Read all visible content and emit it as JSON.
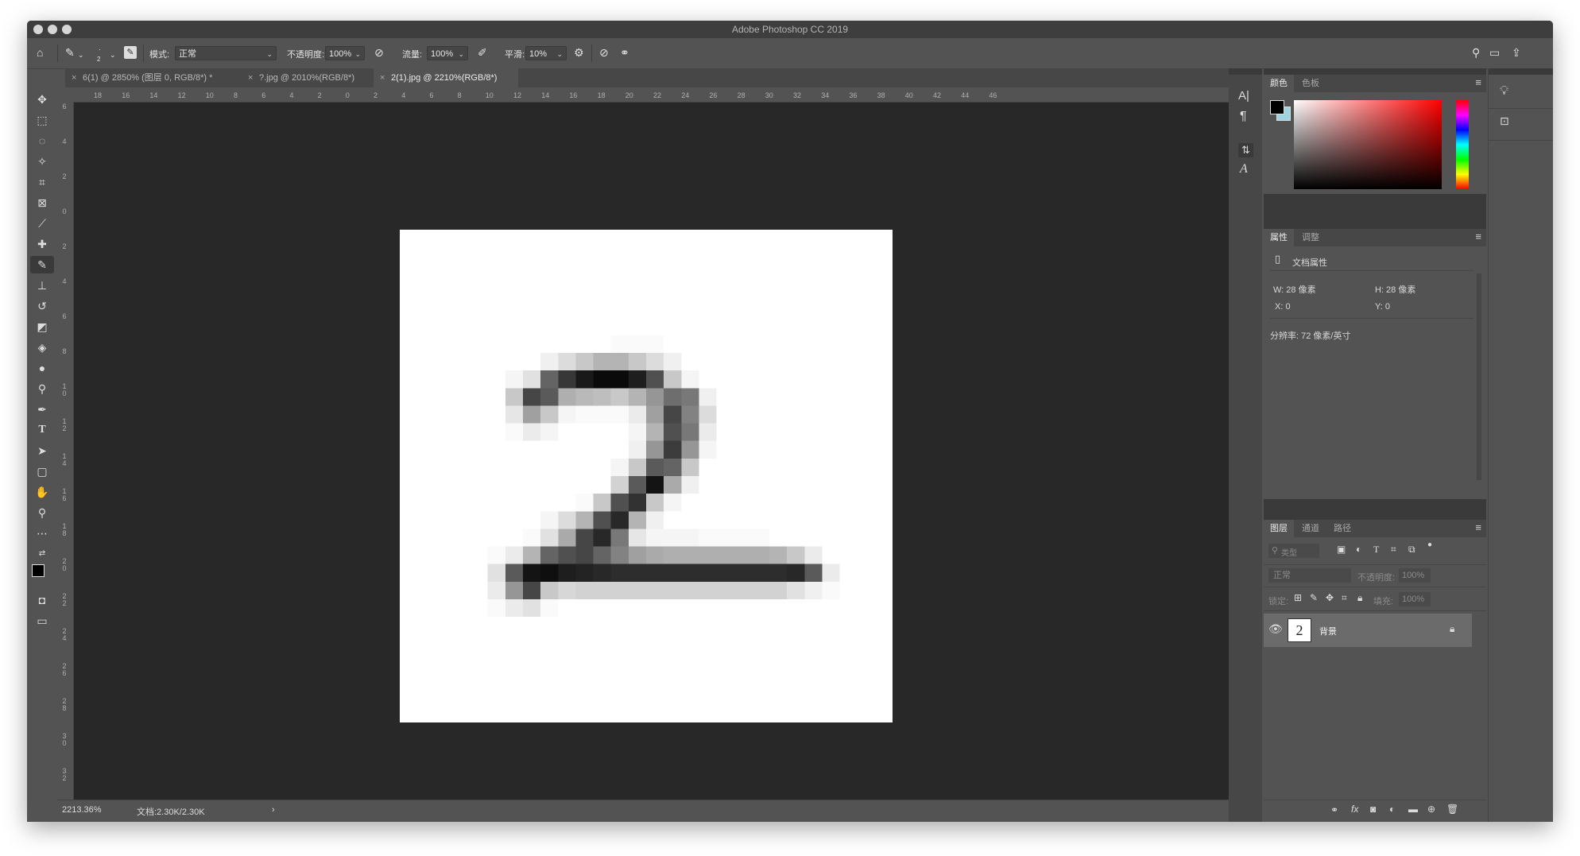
{
  "window": {
    "title": "Adobe Photoshop CC 2019"
  },
  "options_bar": {
    "brush_size": "2",
    "mode_label": "模式:",
    "mode_value": "正常",
    "opacity_label": "不透明度:",
    "opacity_value": "100%",
    "flow_label": "流量:",
    "flow_value": "100%",
    "smoothing_label": "平滑:",
    "smoothing_value": "10%"
  },
  "tabs": [
    {
      "label": "6(1) @ 2850% (图层 0, RGB/8*) *",
      "active": false
    },
    {
      "label": "?.jpg @ 2010%(RGB/8*)",
      "active": false
    },
    {
      "label": "2(1).jpg @ 2210%(RGB/8*)",
      "active": true
    }
  ],
  "tools": [
    "move-tool",
    "marquee-tool",
    "lasso-tool",
    "magic-wand-tool",
    "crop-tool",
    "frame-tool",
    "eyedropper-tool",
    "healing-brush-tool",
    "brush-tool",
    "clone-stamp-tool",
    "history-brush-tool",
    "eraser-tool",
    "paint-bucket-tool",
    "blur-tool",
    "dodge-tool",
    "pen-tool",
    "type-tool",
    "path-selection-tool",
    "shape-tool",
    "hand-tool",
    "zoom-tool",
    "more-tools"
  ],
  "ruler_top": [
    "18",
    "16",
    "14",
    "12",
    "10",
    "8",
    "6",
    "4",
    "2",
    "0",
    "2",
    "4",
    "6",
    "8",
    "10",
    "12",
    "14",
    "16",
    "18",
    "20",
    "22",
    "24",
    "26",
    "28",
    "30",
    "32",
    "34",
    "36",
    "38",
    "40",
    "42",
    "44",
    "46"
  ],
  "ruler_left": [
    "6",
    "4",
    "2",
    "0",
    "2",
    "4",
    "6",
    "8",
    "10",
    "12",
    "14",
    "16",
    "18",
    "20",
    "22",
    "24",
    "26",
    "28",
    "30",
    "32"
  ],
  "pixel_grid": {
    "size": 28,
    "rows": [
      [
        255,
        255,
        255,
        255,
        255,
        255,
        255,
        255,
        255,
        255,
        255,
        255,
        255,
        255,
        255,
        255,
        255,
        255,
        255,
        255,
        255,
        255,
        255,
        255,
        255,
        255,
        255,
        255
      ],
      [
        255,
        255,
        255,
        255,
        255,
        255,
        255,
        255,
        255,
        255,
        255,
        255,
        255,
        255,
        255,
        255,
        255,
        255,
        255,
        255,
        255,
        255,
        255,
        255,
        255,
        255,
        255,
        255
      ],
      [
        255,
        255,
        255,
        255,
        255,
        255,
        255,
        255,
        255,
        255,
        255,
        255,
        255,
        255,
        255,
        255,
        255,
        255,
        255,
        255,
        255,
        255,
        255,
        255,
        255,
        255,
        255,
        255
      ],
      [
        255,
        255,
        255,
        255,
        255,
        255,
        255,
        255,
        255,
        255,
        255,
        255,
        255,
        255,
        255,
        255,
        255,
        255,
        255,
        255,
        255,
        255,
        255,
        255,
        255,
        255,
        255,
        255
      ],
      [
        255,
        255,
        255,
        255,
        255,
        255,
        255,
        255,
        255,
        255,
        255,
        255,
        255,
        255,
        255,
        255,
        255,
        255,
        255,
        255,
        255,
        255,
        255,
        255,
        255,
        255,
        255,
        255
      ],
      [
        255,
        255,
        255,
        255,
        255,
        255,
        255,
        255,
        255,
        255,
        255,
        255,
        255,
        255,
        255,
        255,
        255,
        255,
        255,
        255,
        255,
        255,
        255,
        255,
        255,
        255,
        255,
        255
      ],
      [
        255,
        255,
        255,
        255,
        255,
        255,
        255,
        255,
        255,
        255,
        255,
        255,
        250,
        250,
        250,
        255,
        255,
        255,
        255,
        255,
        255,
        255,
        255,
        255,
        255,
        255,
        255,
        255
      ],
      [
        255,
        255,
        255,
        255,
        255,
        255,
        255,
        255,
        240,
        220,
        200,
        180,
        180,
        200,
        220,
        240,
        255,
        255,
        255,
        255,
        255,
        255,
        255,
        255,
        255,
        255,
        255,
        255
      ],
      [
        255,
        255,
        255,
        255,
        255,
        255,
        245,
        225,
        100,
        55,
        25,
        10,
        10,
        30,
        80,
        200,
        245,
        255,
        255,
        255,
        255,
        255,
        255,
        255,
        255,
        255,
        255,
        255
      ],
      [
        255,
        255,
        255,
        255,
        255,
        255,
        200,
        70,
        90,
        175,
        185,
        190,
        200,
        180,
        150,
        110,
        120,
        240,
        255,
        255,
        255,
        255,
        255,
        255,
        255,
        255,
        255,
        255
      ],
      [
        255,
        255,
        255,
        255,
        255,
        255,
        230,
        160,
        200,
        245,
        250,
        250,
        250,
        235,
        160,
        70,
        130,
        220,
        255,
        255,
        255,
        255,
        255,
        255,
        255,
        255,
        255,
        255
      ],
      [
        255,
        255,
        255,
        255,
        255,
        255,
        250,
        235,
        245,
        255,
        255,
        255,
        255,
        245,
        180,
        80,
        120,
        235,
        255,
        255,
        255,
        255,
        255,
        255,
        255,
        255,
        255,
        255
      ],
      [
        255,
        255,
        255,
        255,
        255,
        255,
        255,
        255,
        255,
        255,
        255,
        255,
        255,
        240,
        150,
        60,
        150,
        245,
        255,
        255,
        255,
        255,
        255,
        255,
        255,
        255,
        255,
        255
      ],
      [
        255,
        255,
        255,
        255,
        255,
        255,
        255,
        255,
        255,
        255,
        255,
        255,
        245,
        200,
        90,
        100,
        200,
        255,
        255,
        255,
        255,
        255,
        255,
        255,
        255,
        255,
        255,
        255
      ],
      [
        255,
        255,
        255,
        255,
        255,
        255,
        255,
        255,
        255,
        255,
        255,
        255,
        210,
        90,
        20,
        170,
        240,
        255,
        255,
        255,
        255,
        255,
        255,
        255,
        255,
        255,
        255,
        255
      ],
      [
        255,
        255,
        255,
        255,
        255,
        255,
        255,
        255,
        255,
        255,
        250,
        200,
        80,
        50,
        200,
        245,
        255,
        255,
        255,
        255,
        255,
        255,
        255,
        255,
        255,
        255,
        255,
        255
      ],
      [
        255,
        255,
        255,
        255,
        255,
        255,
        255,
        255,
        245,
        220,
        180,
        80,
        40,
        180,
        240,
        255,
        255,
        255,
        255,
        255,
        255,
        255,
        255,
        255,
        255,
        255,
        255,
        255
      ],
      [
        255,
        255,
        255,
        255,
        255,
        255,
        255,
        250,
        225,
        170,
        70,
        40,
        120,
        230,
        245,
        245,
        245,
        250,
        250,
        250,
        250,
        255,
        255,
        255,
        255,
        255,
        255,
        255
      ],
      [
        255,
        255,
        255,
        255,
        255,
        250,
        235,
        180,
        100,
        80,
        70,
        100,
        130,
        160,
        170,
        175,
        175,
        175,
        175,
        175,
        175,
        180,
        200,
        235,
        255,
        255,
        255,
        255
      ],
      [
        255,
        255,
        255,
        255,
        255,
        225,
        90,
        20,
        15,
        30,
        35,
        40,
        45,
        45,
        45,
        45,
        45,
        45,
        45,
        45,
        45,
        45,
        40,
        90,
        235,
        255,
        255,
        255
      ],
      [
        255,
        255,
        255,
        255,
        255,
        235,
        150,
        70,
        200,
        215,
        210,
        210,
        210,
        210,
        210,
        210,
        210,
        210,
        210,
        210,
        210,
        210,
        225,
        240,
        250,
        255,
        255,
        255
      ],
      [
        255,
        255,
        255,
        255,
        255,
        250,
        235,
        225,
        250,
        255,
        255,
        255,
        255,
        255,
        255,
        255,
        255,
        255,
        255,
        255,
        255,
        255,
        255,
        255,
        255,
        255,
        255,
        255
      ],
      [
        255,
        255,
        255,
        255,
        255,
        255,
        255,
        255,
        255,
        255,
        255,
        255,
        255,
        255,
        255,
        255,
        255,
        255,
        255,
        255,
        255,
        255,
        255,
        255,
        255,
        255,
        255,
        255
      ],
      [
        255,
        255,
        255,
        255,
        255,
        255,
        255,
        255,
        255,
        255,
        255,
        255,
        255,
        255,
        255,
        255,
        255,
        255,
        255,
        255,
        255,
        255,
        255,
        255,
        255,
        255,
        255,
        255
      ],
      [
        255,
        255,
        255,
        255,
        255,
        255,
        255,
        255,
        255,
        255,
        255,
        255,
        255,
        255,
        255,
        255,
        255,
        255,
        255,
        255,
        255,
        255,
        255,
        255,
        255,
        255,
        255,
        255
      ],
      [
        255,
        255,
        255,
        255,
        255,
        255,
        255,
        255,
        255,
        255,
        255,
        255,
        255,
        255,
        255,
        255,
        255,
        255,
        255,
        255,
        255,
        255,
        255,
        255,
        255,
        255,
        255,
        255
      ],
      [
        255,
        255,
        255,
        255,
        255,
        255,
        255,
        255,
        255,
        255,
        255,
        255,
        255,
        255,
        255,
        255,
        255,
        255,
        255,
        255,
        255,
        255,
        255,
        255,
        255,
        255,
        255,
        255
      ],
      [
        255,
        255,
        255,
        255,
        255,
        255,
        255,
        255,
        255,
        255,
        255,
        255,
        255,
        255,
        255,
        255,
        255,
        255,
        255,
        255,
        255,
        255,
        255,
        255,
        255,
        255,
        255,
        255
      ]
    ]
  },
  "status": {
    "zoom": "2213.36%",
    "doc": "文档:2.30K/2.30K",
    "arrow": "›"
  },
  "color_panel": {
    "tabs": [
      "颜色",
      "色板"
    ],
    "hue_top": "#ff0000",
    "foreground": "#000000",
    "background": "#9fd3e0"
  },
  "properties_panel": {
    "tabs": [
      "属性",
      "调整"
    ],
    "header": "文档属性",
    "w": "W: 28 像素",
    "h": "H: 28 像素",
    "x": "X: 0",
    "y": "Y: 0",
    "resolution": "分辨率: 72 像素/英寸"
  },
  "layers_panel": {
    "tabs": [
      "图层",
      "通道",
      "路径"
    ],
    "filter_placeholder": "类型",
    "blend_mode": "正常",
    "opacity_label": "不透明度:",
    "opacity_value": "100%",
    "lock_label": "锁定:",
    "fill_label": "填充:",
    "fill_value": "100%",
    "layer_name": "背景",
    "layer_thumb_text": "2"
  }
}
